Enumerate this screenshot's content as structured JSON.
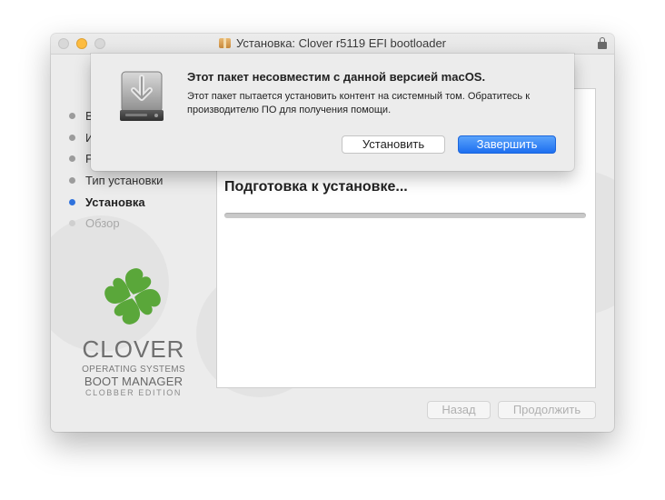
{
  "window": {
    "title": "Установка: Clover r5119 EFI bootloader"
  },
  "sidebar": {
    "items": [
      {
        "label": "В",
        "state": "done"
      },
      {
        "label": "И",
        "state": "done"
      },
      {
        "label": "Р",
        "state": "done"
      },
      {
        "label": "Тип установки",
        "state": "done"
      },
      {
        "label": "Установка",
        "state": "active"
      },
      {
        "label": "Обзор",
        "state": "future"
      }
    ],
    "active_color": "#2f72dd"
  },
  "content": {
    "heading": "Подготовка к установке...",
    "progress": 0
  },
  "branding": {
    "name": "CLOVER",
    "line1": "OPERATING SYSTEMS",
    "line2": "BOOT MANAGER",
    "line3": "CLOBBER EDITION",
    "logo_color": "#5aa73a"
  },
  "footer": {
    "back_label": "Назад",
    "continue_label": "Продолжить"
  },
  "alert": {
    "title": "Этот пакет несовместим с данной версией macOS.",
    "message": "Этот пакет пытается установить контент на системный том. Обратитесь к производителю ПО для получения помощи.",
    "install_label": "Установить",
    "finish_label": "Завершить",
    "primary_color": "#1d6ff0",
    "icon": "hard-drive-download-icon"
  }
}
